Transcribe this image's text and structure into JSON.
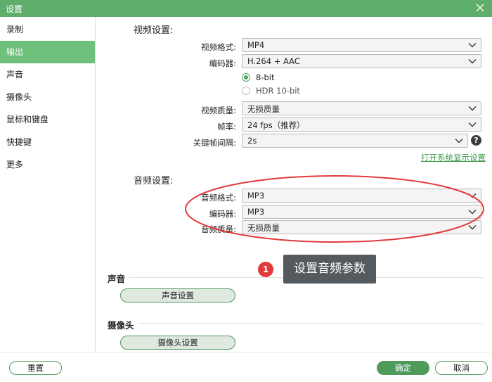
{
  "window": {
    "title": "设置"
  },
  "sidebar": {
    "items": [
      {
        "label": "录制"
      },
      {
        "label": "输出"
      },
      {
        "label": "声音"
      },
      {
        "label": "摄像头"
      },
      {
        "label": "鼠标和键盘"
      },
      {
        "label": "快捷键"
      },
      {
        "label": "更多"
      }
    ],
    "active": "输出"
  },
  "video": {
    "section_title": "视频设置:",
    "format_label": "视频格式:",
    "format_value": "MP4",
    "encoder_label": "编码器:",
    "encoder_value": "H.264 + AAC",
    "bitdepth_options": [
      {
        "label": "8-bit",
        "checked": true
      },
      {
        "label": "HDR 10-bit",
        "checked": false
      }
    ],
    "quality_label": "视频质量:",
    "quality_value": "无损质量",
    "fps_label": "帧率:",
    "fps_value": "24 fps（推荐）",
    "keyframe_label": "关键帧间隔:",
    "keyframe_value": "2s",
    "help_glyph": "?",
    "display_link": "打开系统显示设置"
  },
  "audio": {
    "section_title": "音频设置:",
    "format_label": "音频格式:",
    "format_value": "MP3",
    "encoder_label": "编码器:",
    "encoder_value": "MP3",
    "quality_label": "音频质量:",
    "quality_value": "无损质量"
  },
  "annotation": {
    "badge": "1",
    "callout": "设置音频参数",
    "color": "#e23a3a"
  },
  "sound": {
    "heading": "声音",
    "button": "声音设置"
  },
  "camera": {
    "heading": "摄像头",
    "button": "摄像头设置"
  },
  "footer": {
    "reset": "重置",
    "ok": "确定",
    "cancel": "取消"
  },
  "colors": {
    "accent": "#5fae6c",
    "active_item": "#6ec07a",
    "primary_button": "#4f9a5b"
  }
}
